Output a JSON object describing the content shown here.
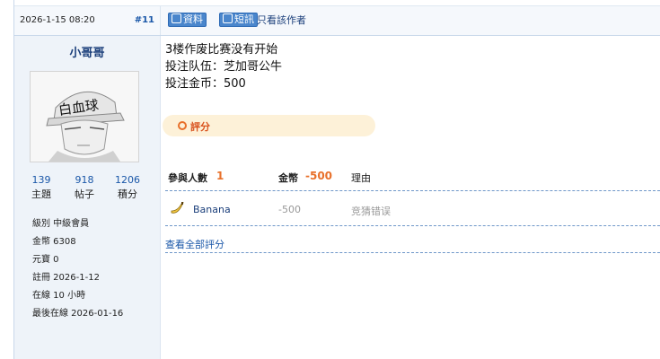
{
  "post": {
    "date": "2026-1-15 08:20",
    "floor": "#11",
    "buttons": {
      "profile": "資料",
      "message": "短訊"
    },
    "only_author": "只看該作者"
  },
  "author": {
    "name": "小哥哥",
    "avatar_text": "白血球",
    "stats": [
      {
        "value": "139",
        "label": "主題"
      },
      {
        "value": "918",
        "label": "帖子"
      },
      {
        "value": "1206",
        "label": "積分"
      }
    ],
    "info": [
      "級別 中級會員",
      "金幣 6308",
      "元寶 0",
      "註冊 2026-1-12",
      "在線 10 小時",
      "最後在線 2026-01-16"
    ]
  },
  "content": {
    "lines": [
      "3楼作废比赛没有开始",
      "投注队伍：芝加哥公牛",
      "投注金币：500"
    ]
  },
  "rating": {
    "label": "評分",
    "header": {
      "participants_label": "參與人數",
      "participants": "1",
      "coins_label": "金幣",
      "coins": "-500",
      "reason_label": "理由"
    },
    "rows": [
      {
        "user": "Banana",
        "value": "-500",
        "reason": "竞猜错误"
      }
    ],
    "view_all": "查看全部評分"
  }
}
